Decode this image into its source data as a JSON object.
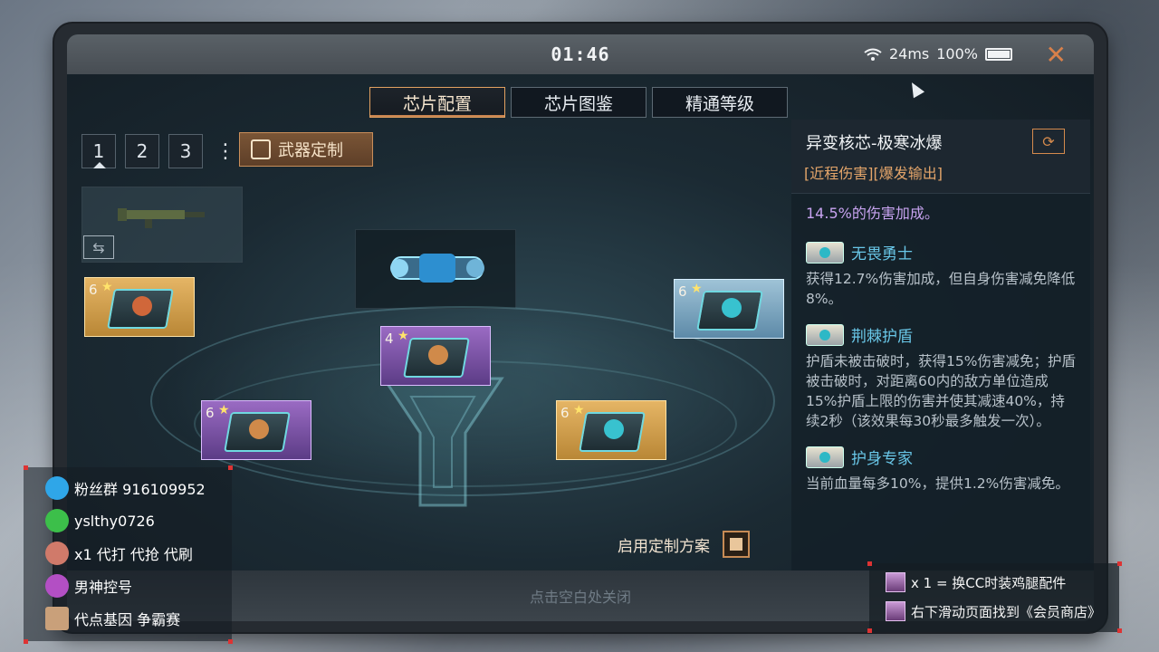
{
  "status": {
    "time": "01:46",
    "ping": "24ms",
    "battery": "100%"
  },
  "tabs": [
    {
      "label": "芯片配置",
      "active": true
    },
    {
      "label": "芯片图鉴",
      "active": false
    },
    {
      "label": "精通等级",
      "active": false
    }
  ],
  "pages": [
    "1",
    "2",
    "3"
  ],
  "custom_button": "武器定制",
  "chips": [
    {
      "level": "6",
      "rarity": "gold"
    },
    {
      "level": "4",
      "rarity": "purple"
    },
    {
      "level": "6",
      "rarity": "blue"
    },
    {
      "level": "6",
      "rarity": "purple"
    },
    {
      "level": "6",
      "rarity": "gold"
    }
  ],
  "apply_label": "启用定制方案",
  "footer_hint": "点击空白处关闭",
  "panel": {
    "title": "异变核芯-极寒冰爆",
    "tags": "[近程伤害][爆发输出]",
    "truncated": "14.5%的伤害加成。",
    "effects": [
      {
        "title": "无畏勇士",
        "desc": "获得12.7%伤害加成，但自身伤害减免降低8%。"
      },
      {
        "title": "荆棘护盾",
        "desc": "护盾未被击破时，获得15%伤害减免；护盾被击破时，对距离60内的敌方单位造成15%护盾上限的伤害并使其减速40%，持续2秒（该效果每30秒最多触发一次）。"
      },
      {
        "title": "护身专家",
        "desc": "当前血量每多10%，提供1.2%伤害减免。"
      }
    ]
  },
  "overlay_left": [
    {
      "text": "粉丝群 916109952",
      "icon": "qq-icon",
      "color": "#2fa6e8"
    },
    {
      "text": "yslthy0726",
      "icon": "wechat-icon",
      "color": "#3cbf4a"
    },
    {
      "text": "x1 代打 代抢 代刷",
      "icon": "character-icon",
      "color": "#d07a6a"
    },
    {
      "text": "男神控号",
      "icon": "rocket-icon",
      "color": "#b34fc4"
    },
    {
      "text": "代点基因 争霸赛",
      "icon": "card-icon",
      "color": "#c9a07a"
    }
  ],
  "overlay_right": [
    {
      "text": "x 1 = 换CC时装鸡腿配件"
    },
    {
      "text": "右下滑动页面找到《会员商店》"
    }
  ]
}
